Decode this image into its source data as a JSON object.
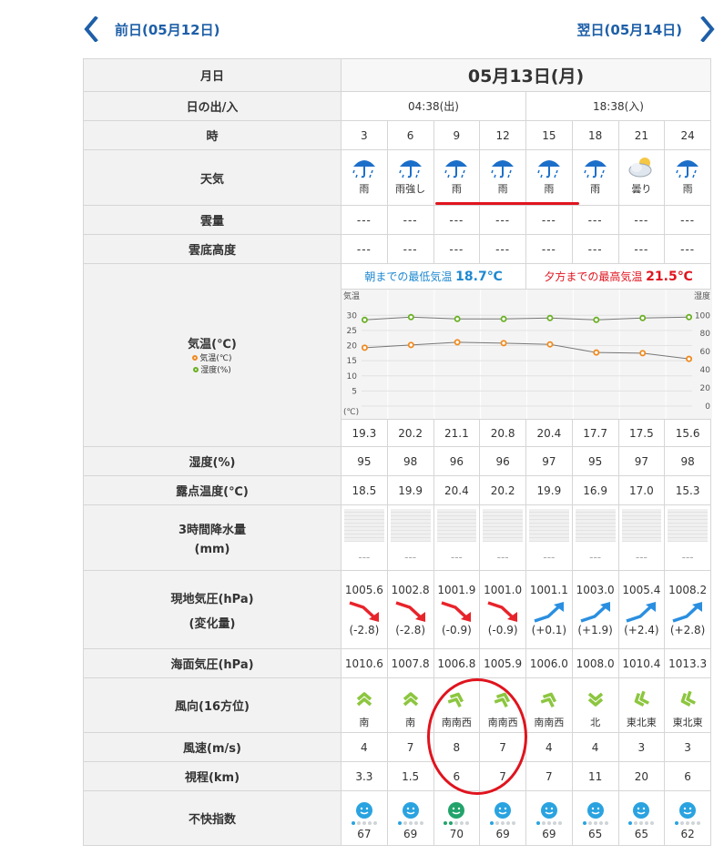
{
  "nav": {
    "prev_label": "前日(05月12日)",
    "next_label": "翌日(05月14日)"
  },
  "rows": {
    "date": "月日",
    "sun": "日の出/入",
    "hour": "時",
    "weather": "天気",
    "cloud": "雲量",
    "cloud_base": "雲底高度",
    "temp": "気温(℃)",
    "humidity": "湿度(%)",
    "dewpoint": "露点温度(℃)",
    "precip_1": "3時間降水量",
    "precip_2": "(mm)",
    "pressure_1": "現地気圧(hPa)",
    "pressure_2": "(変化量)",
    "sea_pressure": "海面気圧(hPa)",
    "wind_dir": "風向(16方位)",
    "wind_speed": "風速(m/s)",
    "visibility": "視程(km)",
    "discomfort": "不快指数"
  },
  "legend": {
    "temp": "気温(℃)",
    "humidity": "湿度(%)"
  },
  "date": "05月13日(月)",
  "sunrise": "04:38(出)",
  "sunset": "18:38(入)",
  "highlights": {
    "min_label": "朝までの最低気温",
    "min_value": "18.7℃",
    "max_label": "夕方までの最高気温",
    "max_value": "21.5℃"
  },
  "dash": "---",
  "hours": [
    "3",
    "6",
    "9",
    "12",
    "15",
    "18",
    "21",
    "24"
  ],
  "weather": [
    {
      "label": "雨",
      "icon": "umbrella-rain-icon"
    },
    {
      "label": "雨強し",
      "icon": "umbrella-rain-icon"
    },
    {
      "label": "雨",
      "icon": "umbrella-rain-icon"
    },
    {
      "label": "雨",
      "icon": "umbrella-rain-icon"
    },
    {
      "label": "雨",
      "icon": "umbrella-rain-icon"
    },
    {
      "label": "雨",
      "icon": "umbrella-rain-icon"
    },
    {
      "label": "曇り",
      "icon": "cloud-icon"
    },
    {
      "label": "雨",
      "icon": "umbrella-rain-icon"
    }
  ],
  "temps": [
    "19.3",
    "20.2",
    "21.1",
    "20.8",
    "20.4",
    "17.7",
    "17.5",
    "15.6"
  ],
  "humidity": [
    "95",
    "98",
    "96",
    "96",
    "97",
    "95",
    "97",
    "98"
  ],
  "dewpoint": [
    "18.5",
    "19.9",
    "20.4",
    "20.2",
    "19.9",
    "16.9",
    "17.0",
    "15.3"
  ],
  "pressure": [
    "1005.6",
    "1002.8",
    "1001.9",
    "1001.0",
    "1001.1",
    "1003.0",
    "1005.4",
    "1008.2"
  ],
  "pressure_change": [
    "(-2.8)",
    "(-2.8)",
    "(-0.9)",
    "(-0.9)",
    "(+0.1)",
    "(+1.9)",
    "(+2.4)",
    "(+2.8)"
  ],
  "sea_pressure": [
    "1010.6",
    "1007.8",
    "1006.8",
    "1005.9",
    "1006.0",
    "1008.0",
    "1010.4",
    "1013.3"
  ],
  "wind_dir": [
    "南",
    "南",
    "南南西",
    "南南西",
    "南南西",
    "北",
    "東北東",
    "東北東"
  ],
  "wind_speed": [
    "4",
    "7",
    "8",
    "7",
    "4",
    "4",
    "3",
    "3"
  ],
  "visibility": [
    "3.3",
    "1.5",
    "6",
    "7",
    "7",
    "11",
    "20",
    "6"
  ],
  "discomfort": [
    "67",
    "69",
    "70",
    "69",
    "69",
    "65",
    "65",
    "62"
  ],
  "chart_data": {
    "type": "line",
    "x": [
      3,
      6,
      9,
      12,
      15,
      18,
      21,
      24
    ],
    "left_axis": {
      "label": "気温",
      "unit": "(℃)",
      "ticks": [
        30,
        25,
        20,
        15,
        10,
        5
      ],
      "range": [
        0,
        32.5
      ]
    },
    "right_axis": {
      "label": "湿度",
      "ticks": [
        100,
        80,
        60,
        40,
        20,
        0
      ],
      "range": [
        0,
        100
      ]
    },
    "series": [
      {
        "name": "気温(℃)",
        "axis": "left",
        "color": "#f08a1e",
        "values": [
          19.3,
          20.2,
          21.1,
          20.8,
          20.4,
          17.7,
          17.5,
          15.6
        ]
      },
      {
        "name": "湿度(%)",
        "axis": "right",
        "color": "#6ab023",
        "values": [
          95,
          98,
          96,
          96,
          97,
          95,
          97,
          98
        ]
      }
    ]
  },
  "colors": {
    "nav": "#1e5fa8",
    "min_temp": "#1e88d0",
    "max_temp": "#e0141e",
    "arrow_down": "#e8232a",
    "arrow_up": "#2a8fe0",
    "wind": "#8cc63f",
    "face": "#2aa3e0",
    "face_green": "#23a36b"
  }
}
